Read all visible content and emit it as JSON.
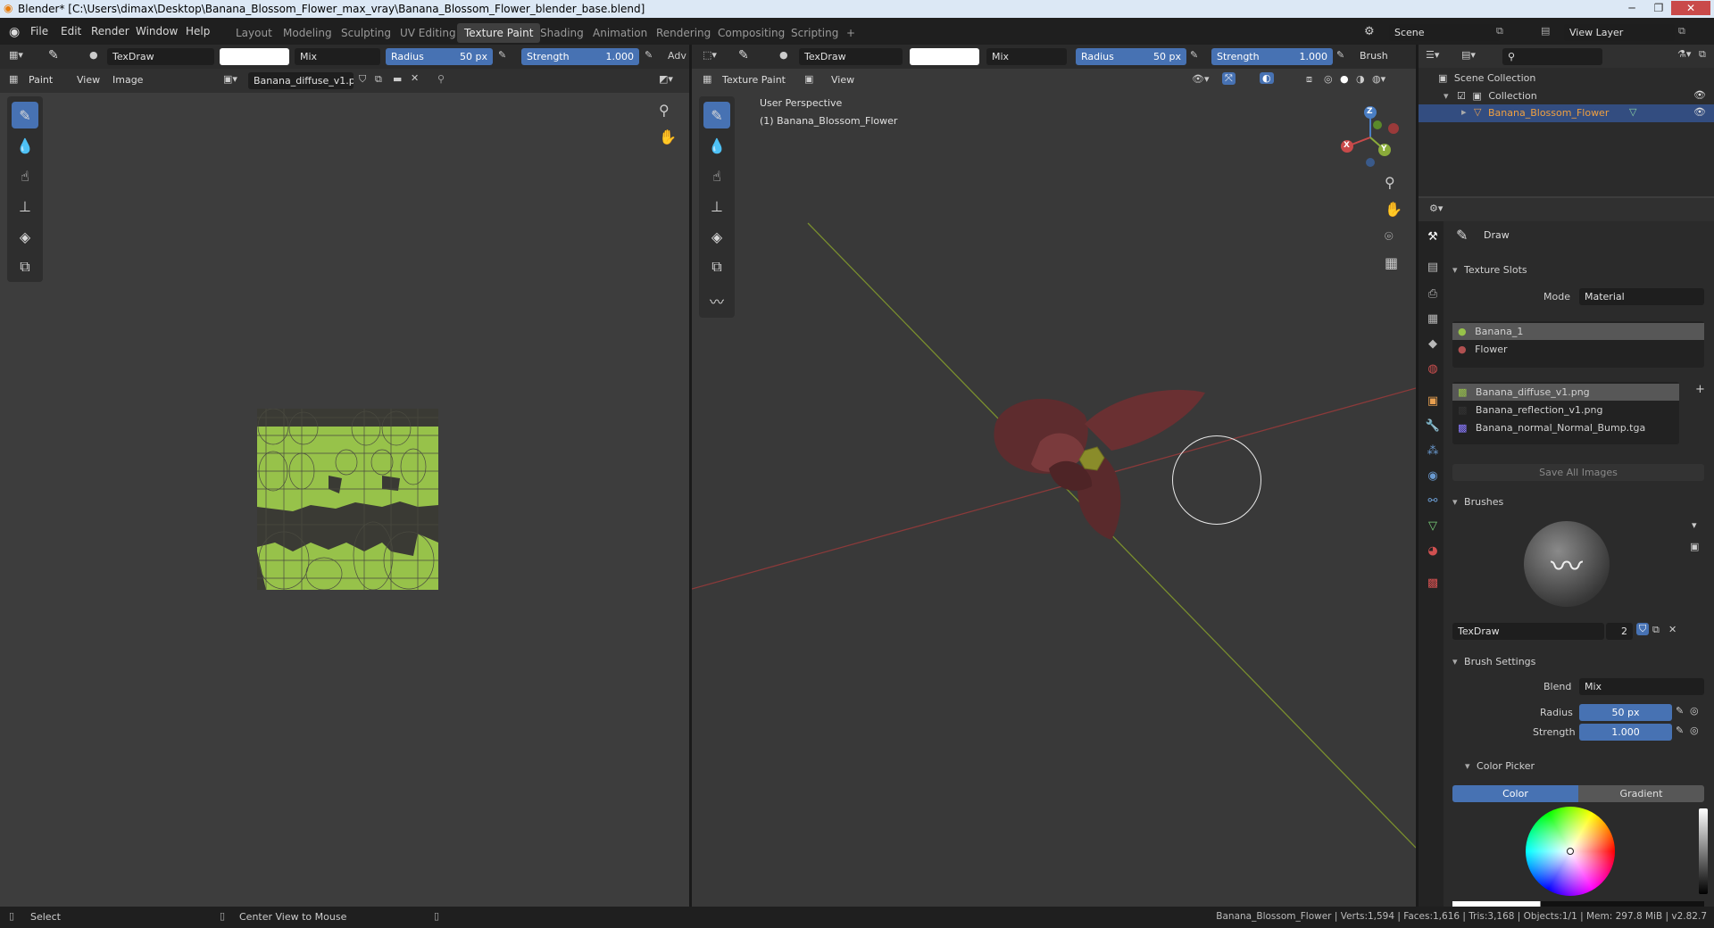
{
  "window": {
    "title": "Blender* [C:\\Users\\dimax\\Desktop\\Banana_Blossom_Flower_max_vray\\Banana_Blossom_Flower_blender_base.blend]",
    "min": "─",
    "max": "❐",
    "close": "✕"
  },
  "menu": [
    "File",
    "Edit",
    "Render",
    "Window",
    "Help"
  ],
  "workspaces": [
    "Layout",
    "Modeling",
    "Sculpting",
    "UV Editing",
    "Texture Paint",
    "Shading",
    "Animation",
    "Rendering",
    "Compositing",
    "Scripting",
    "+"
  ],
  "scene": {
    "name": "Scene",
    "view_layer": "View Layer"
  },
  "image_editor": {
    "brush_name": "TexDraw",
    "blend": "Mix",
    "radius_label": "Radius",
    "radius_value": "50 px",
    "strength_label": "Strength",
    "strength_value": "1.000",
    "adv": "Adv",
    "mode": "Paint",
    "view": "View",
    "image_menu": "Image",
    "image_name": "Banana_diffuse_v1.p.."
  },
  "viewport": {
    "brush_name": "TexDraw",
    "blend": "Mix",
    "radius_label": "Radius",
    "radius_value": "50 px",
    "strength_label": "Strength",
    "strength_value": "1.000",
    "brush_menu": "Brush",
    "mode": "Texture Paint",
    "view": "View",
    "overlay_line1": "User Perspective",
    "overlay_line2": "(1) Banana_Blossom_Flower",
    "gizmo": {
      "x": "X",
      "y": "Y",
      "z": "Z"
    }
  },
  "outliner": {
    "scene_collection": "Scene Collection",
    "collection": "Collection",
    "object": "Banana_Blossom_Flower"
  },
  "properties": {
    "tool_name": "Draw",
    "texture_slots_title": "Texture Slots",
    "mode_label": "Mode",
    "mode_value": "Material",
    "materials": [
      "Banana_1",
      "Flower"
    ],
    "textures": [
      "Banana_diffuse_v1.png",
      "Banana_reflection_v1.png",
      "Banana_normal_Normal_Bump.tga"
    ],
    "save_all": "Save All Images",
    "brushes_title": "Brushes",
    "brush_name": "TexDraw",
    "brush_users": "2",
    "brush_settings_title": "Brush Settings",
    "blend_label": "Blend",
    "blend_value": "Mix",
    "radius_label": "Radius",
    "radius_value": "50 px",
    "strength_label": "Strength",
    "strength_value": "1.000",
    "color_picker_title": "Color Picker",
    "color_tab": "Color",
    "gradient_tab": "Gradient"
  },
  "statusbar": {
    "select": "Select",
    "center": "Center View to Mouse",
    "stats": "Banana_Blossom_Flower | Verts:1,594 | Faces:1,616 | Tris:3,168 | Objects:1/1 | Mem: 297.8 MiB | v2.82.7"
  },
  "colors": {
    "accent": "#4772b3",
    "uv_green": "#97c24a",
    "petal": "#5e2c2e",
    "x_axis": "#c94a4a",
    "y_axis": "#8aab3a"
  },
  "icons": [
    "blender-logo",
    "brush-icon",
    "fill-icon",
    "smear-icon",
    "clone-icon",
    "mask-icon",
    "zoom-icon",
    "hand-icon",
    "camera-icon",
    "grid-icon",
    "eye-icon",
    "search-icon",
    "filter-icon"
  ]
}
